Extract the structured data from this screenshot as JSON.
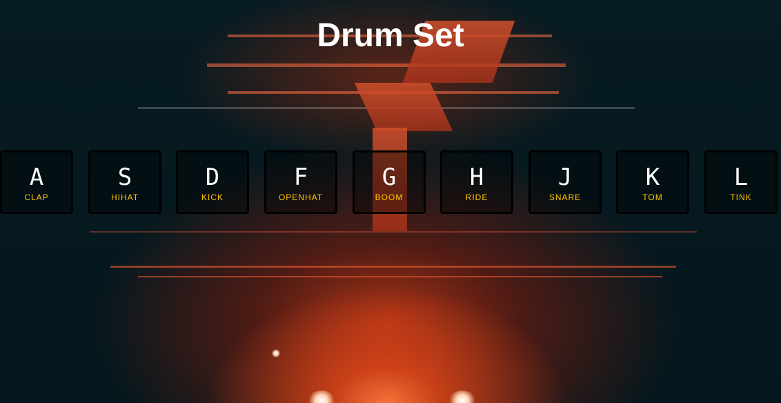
{
  "page": {
    "title": "Drum Set",
    "background_image": "concert-stage-lights"
  },
  "colors": {
    "title": "#ffffff",
    "key_letter": "#ffffff",
    "sound_label": "#ffc600",
    "key_border": "#000000",
    "background_dark": "#05171d",
    "stage_glow": "#e84c1c"
  },
  "keys": [
    {
      "letter": "A",
      "sound": "CLAP"
    },
    {
      "letter": "S",
      "sound": "HIHAT"
    },
    {
      "letter": "D",
      "sound": "KICK"
    },
    {
      "letter": "F",
      "sound": "OPENHAT"
    },
    {
      "letter": "G",
      "sound": "BOOM"
    },
    {
      "letter": "H",
      "sound": "RIDE"
    },
    {
      "letter": "J",
      "sound": "SNARE"
    },
    {
      "letter": "K",
      "sound": "TOM"
    },
    {
      "letter": "L",
      "sound": "TINK"
    }
  ]
}
